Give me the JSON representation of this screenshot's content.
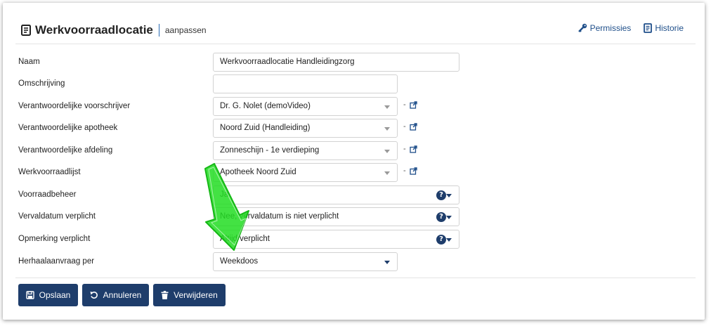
{
  "header": {
    "title": "Werkvoorraadlocatie",
    "subtitle": "aanpassen",
    "links": [
      {
        "label": "Permissies",
        "icon": "key-icon"
      },
      {
        "label": "Historie",
        "icon": "document-icon"
      }
    ]
  },
  "form": {
    "fields": [
      {
        "label": "Naam",
        "value": "Werkvoorraadlocatie Handleidingzorg",
        "type": "text"
      },
      {
        "label": "Omschrijving",
        "value": "",
        "type": "text"
      },
      {
        "label": "Verantwoordelijke voorschrijver",
        "value": "Dr. G. Nolet (demoVideo)",
        "type": "select-link"
      },
      {
        "label": "Verantwoordelijke apotheek",
        "value": "Noord Zuid (Handleiding)",
        "type": "select-link"
      },
      {
        "label": "Verantwoordelijke afdeling",
        "value": "Zonneschijn - 1e verdieping",
        "type": "select-link"
      },
      {
        "label": "Werkvoorraadlijst",
        "value": "Apotheek Noord Zuid",
        "type": "select-link"
      },
      {
        "label": "Voorraadbeheer",
        "value": "Ja",
        "type": "select-help"
      },
      {
        "label": "Vervaldatum verplicht",
        "value": "Nee, vervaldatum is niet verplicht",
        "type": "select-help"
      },
      {
        "label": "Opmerking verplicht",
        "value": "Altijd verplicht",
        "type": "select-help"
      },
      {
        "label": "Herhaalaanvraag per",
        "value": "Weekdoos",
        "type": "select"
      }
    ],
    "link_separator": "-"
  },
  "buttons": {
    "save": "Opslaan",
    "cancel": "Annuleren",
    "delete": "Verwijderen"
  },
  "colors": {
    "primary": "#1e3d6b",
    "link": "#1f4f8a",
    "annotation_arrow": "#22dd22"
  }
}
